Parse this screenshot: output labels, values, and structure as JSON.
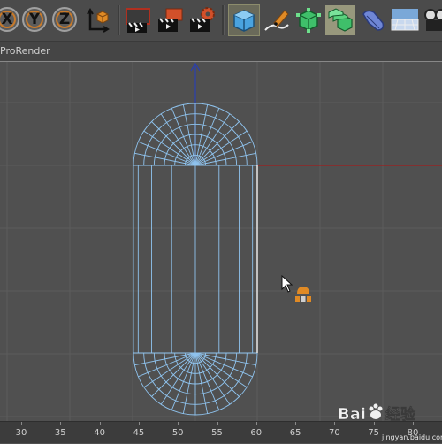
{
  "toolbar": {
    "axis_lock_x": "X",
    "axis_lock_y": "Y",
    "axis_lock_z": "Z",
    "icons": [
      "world-coordinates-icon",
      "render-view-icon",
      "render-picture-viewer-icon",
      "render-settings-icon",
      "cube-primitive-icon",
      "pen-spline-icon",
      "subdivision-surface-icon",
      "cloner-icon",
      "deformer-icon",
      "scene-camera-icon",
      "floor-environment-icon"
    ]
  },
  "viewport_menu": {
    "title": "ProRender"
  },
  "ruler": {
    "labels": [
      "30",
      "35",
      "40",
      "45",
      "50",
      "55",
      "60",
      "65",
      "70",
      "75",
      "80"
    ]
  },
  "watermark": {
    "brand": "Bai",
    "brand_suffix": "经验",
    "url": "jingyan.baidu.com"
  },
  "colors": {
    "viewport_bg": "#505050",
    "grid_line": "#5c5c5c",
    "wireframe": "#8fc3ee",
    "axis_y": "#2a3fb0",
    "axis_x": "#a01e1e",
    "accent_orange": "#e08a25"
  }
}
